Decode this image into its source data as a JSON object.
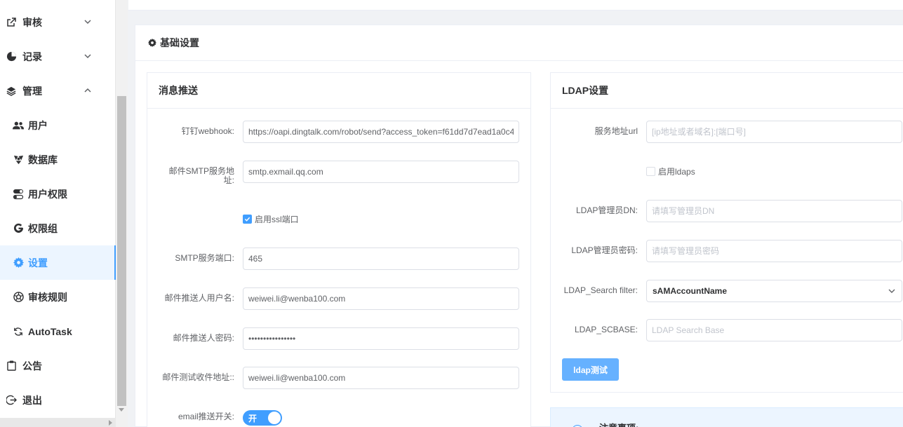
{
  "sidebar": {
    "items": [
      {
        "label": "审核",
        "icon": "external-link-icon"
      },
      {
        "label": "记录",
        "icon": "pie-chart-icon"
      },
      {
        "label": "管理",
        "icon": "layers-icon"
      },
      {
        "label": "用户",
        "icon": "users-icon"
      },
      {
        "label": "数据库",
        "icon": "database-icon"
      },
      {
        "label": "用户权限",
        "icon": "toggle-icon"
      },
      {
        "label": "权限组",
        "icon": "google-icon"
      },
      {
        "label": "设置",
        "icon": "gear-icon"
      },
      {
        "label": "审核规则",
        "icon": "aperture-icon"
      },
      {
        "label": "AutoTask",
        "icon": "refresh-icon"
      },
      {
        "label": "公告",
        "icon": "clipboard-icon"
      },
      {
        "label": "退出",
        "icon": "logout-icon"
      }
    ],
    "active": "设置",
    "accent": "#409eff"
  },
  "main": {
    "title": "基础设置"
  },
  "message_panel": {
    "title": "消息推送",
    "dingtalk_label": "钉钉webhook:",
    "dingtalk_value": "https://oapi.dingtalk.com/robot/send?access_token=f61dd7d7ead1a0c4",
    "smtp_host_label": "邮件SMTP服务地址:",
    "smtp_host_value": "smtp.exmail.qq.com",
    "ssl_label": "启用ssl端口",
    "ssl_checked": true,
    "smtp_port_label": "SMTP服务端口:",
    "smtp_port_value": "465",
    "mail_user_label": "邮件推送人用户名:",
    "mail_user_value": "weiwei.li@wenba100.com",
    "mail_pass_label": "邮件推送人密码:",
    "mail_pass_value": "••••••••••••••••",
    "mail_test_label": "邮件测试收件地址::",
    "mail_test_value": "weiwei.li@wenba100.com",
    "email_switch_label": "email推送开关:",
    "email_switch_text": "开"
  },
  "ldap_panel": {
    "title": "LDAP设置",
    "url_label": "服务地址url",
    "url_placeholder": "[ip地址或者域名]:[端口号]",
    "ldaps_label": "启用ldaps",
    "ldaps_checked": false,
    "admin_dn_label": "LDAP管理员DN:",
    "admin_dn_placeholder": "请填写管理员DN",
    "admin_pass_label": "LDAP管理员密码:",
    "admin_pass_placeholder": "请填写管理员密码",
    "filter_label": "LDAP_Search filter:",
    "filter_value": "sAMAccountName",
    "scbase_label": "LDAP_SCBASE:",
    "scbase_placeholder": "LDAP Search Base",
    "test_button": "ldap测试"
  },
  "notice": {
    "title": "注意事项:"
  }
}
